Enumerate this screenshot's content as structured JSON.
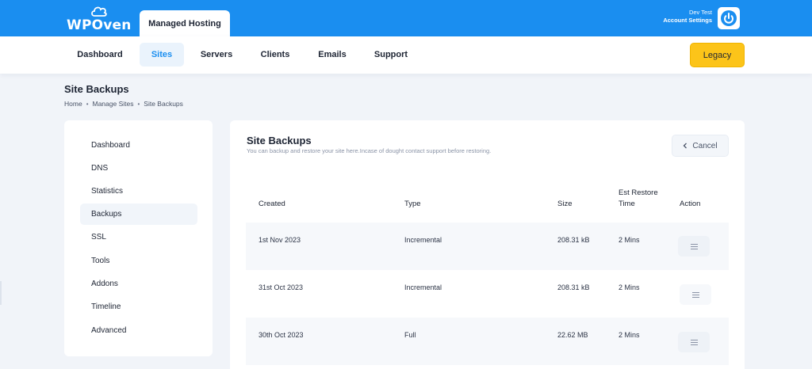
{
  "brand": {
    "logo_text": "WPOven",
    "accent": "#1a8ef0",
    "legacy_color": "#fcc419"
  },
  "header": {
    "product_tab": "Managed Hosting",
    "account_name": "Dev Test",
    "account_link": "Account Settings",
    "power_icon": "power-icon"
  },
  "nav": {
    "items": [
      {
        "label": "Dashboard"
      },
      {
        "label": "Sites"
      },
      {
        "label": "Servers"
      },
      {
        "label": "Clients"
      },
      {
        "label": "Emails"
      },
      {
        "label": "Support"
      }
    ],
    "active": "Sites",
    "legacy_label": "Legacy"
  },
  "page": {
    "title": "Site Backups",
    "breadcrumb": [
      "Home",
      "Manage Sites",
      "Site Backups"
    ],
    "breadcrumb_sep": "•"
  },
  "sidebar": {
    "items": [
      {
        "label": "Dashboard"
      },
      {
        "label": "DNS"
      },
      {
        "label": "Statistics"
      },
      {
        "label": "Backups"
      },
      {
        "label": "SSL"
      },
      {
        "label": "Tools"
      },
      {
        "label": "Addons"
      },
      {
        "label": "Timeline"
      },
      {
        "label": "Advanced"
      }
    ],
    "active": "Backups"
  },
  "main": {
    "title": "Site Backups",
    "subtitle": "You can backup and restore your site here.Incase of dought contact support before restoring.",
    "cancel_label": "Cancel",
    "cancel_icon": "chevron-left-icon",
    "columns": {
      "created": "Created",
      "type": "Type",
      "size": "Size",
      "restore_line1": "Est Restore",
      "restore_line2": "Time",
      "action": "Action"
    },
    "rows": [
      {
        "created": "1st Nov 2023",
        "type": "Incremental",
        "size": "208.31 kB",
        "restore": "2 Mins"
      },
      {
        "created": "31st Oct 2023",
        "type": "Incremental",
        "size": "208.31 kB",
        "restore": "2 Mins"
      },
      {
        "created": "30th Oct 2023",
        "type": "Full",
        "size": "22.62 MB",
        "restore": "2 Mins"
      }
    ],
    "action_icon": "menu-lines-icon"
  }
}
